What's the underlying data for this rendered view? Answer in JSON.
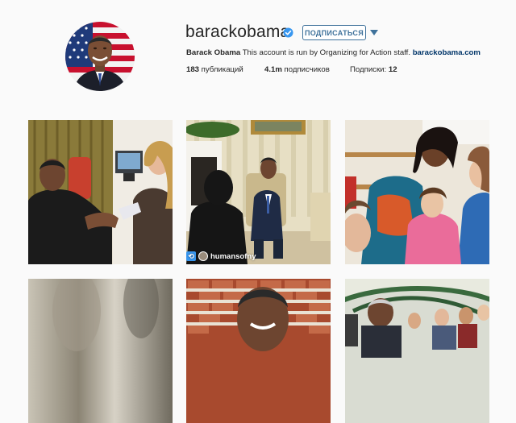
{
  "profile": {
    "username": "barackobama",
    "verified_icon": "verified-badge-icon",
    "follow_label": "ПОДПИСАТЬСЯ",
    "dropdown_icon": "caret-down-icon",
    "bio_name": "Barack Obama",
    "bio_text": " This account is run by Organizing for Action staff. ",
    "bio_link": "barackobama.com",
    "stats": {
      "posts_count": "183",
      "posts_label": " публикаций",
      "followers_count": "4.1m",
      "followers_label": " подписчиков",
      "following_label": "Подписки: ",
      "following_count": "12"
    }
  },
  "posts": [
    {
      "id": "post-1",
      "kind": "flu-shot"
    },
    {
      "id": "post-2",
      "kind": "oval-office",
      "tag_user": "humansofny",
      "tag_icon": "repost-icon"
    },
    {
      "id": "post-3",
      "kind": "hug"
    },
    {
      "id": "post-4",
      "kind": "blurred"
    },
    {
      "id": "post-5",
      "kind": "brick-wall"
    },
    {
      "id": "post-6",
      "kind": "crowd"
    }
  ],
  "colors": {
    "background": "#fafafa",
    "accent": "#3f729b",
    "verified": "#3897f0",
    "link": "#003569"
  }
}
